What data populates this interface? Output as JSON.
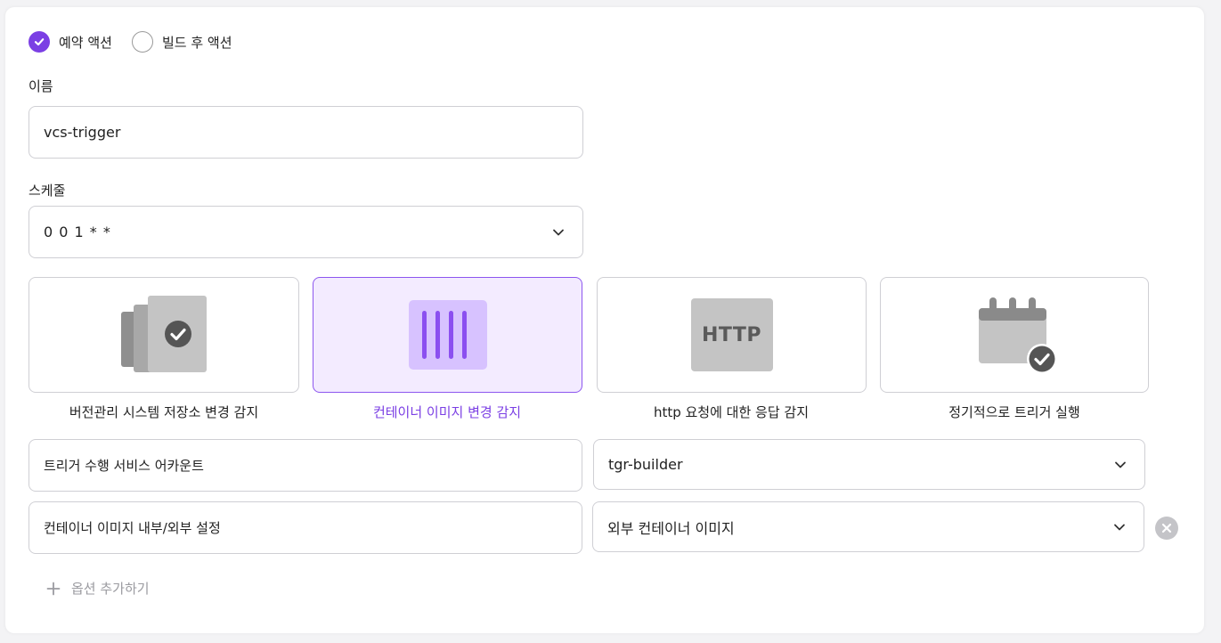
{
  "action_type": {
    "options": [
      {
        "label": "예약 액션",
        "checked": true
      },
      {
        "label": "빌드 후 액션",
        "checked": false
      }
    ]
  },
  "name_field": {
    "label": "이름",
    "value": "vcs-trigger"
  },
  "schedule_field": {
    "label": "스케줄",
    "value": "0 0 1 * *"
  },
  "trigger_types": [
    {
      "label": "버전관리 시스템 저장소 변경 감지",
      "icon": "vcs-repository-icon",
      "selected": false
    },
    {
      "label": "컨테이너 이미지 변경 감지",
      "icon": "container-image-icon",
      "selected": true
    },
    {
      "label": "http 요청에 대한 응답 감지",
      "icon": "http-icon",
      "selected": false,
      "icon_text": "HTTP"
    },
    {
      "label": "정기적으로 트리거 실행",
      "icon": "calendar-check-icon",
      "selected": false
    }
  ],
  "options": [
    {
      "key": "트리거 수행 서비스 어카운트",
      "value": "tgr-builder",
      "removable": false
    },
    {
      "key": "컨테이너 이미지 내부/외부 설정",
      "value": "외부 컨테이너 이미지",
      "removable": true
    }
  ],
  "add_option_label": "옵션 추가하기",
  "colors": {
    "accent": "#7b3fe4",
    "selected_bg": "#f3ebff",
    "border": "#cfcfd4"
  }
}
